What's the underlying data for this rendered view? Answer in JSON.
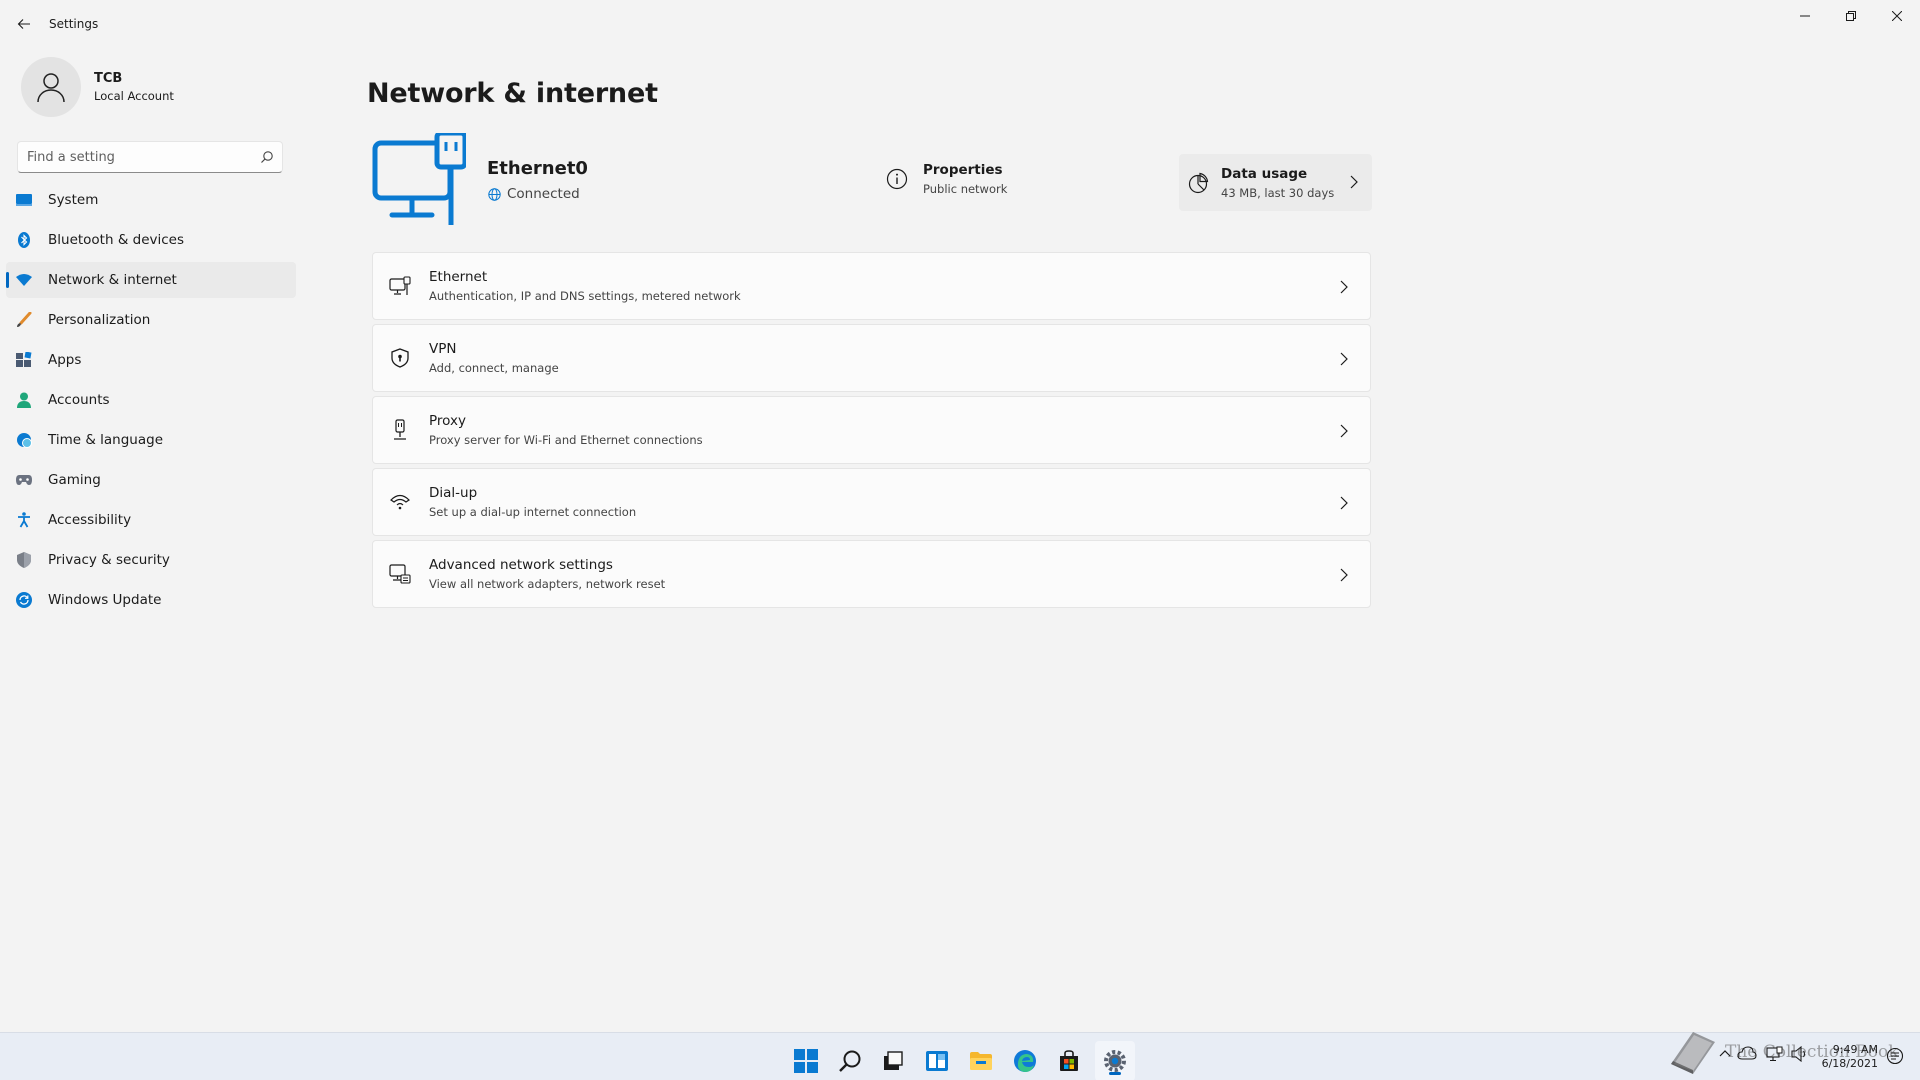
{
  "window": {
    "app_title": "Settings"
  },
  "profile": {
    "name": "TCB",
    "account_type": "Local Account"
  },
  "search": {
    "placeholder": "Find a setting"
  },
  "sidebar": {
    "items": [
      {
        "label": "System",
        "icon": "system-icon",
        "active": false
      },
      {
        "label": "Bluetooth & devices",
        "icon": "bluetooth-icon",
        "active": false
      },
      {
        "label": "Network & internet",
        "icon": "wifi-icon",
        "active": true
      },
      {
        "label": "Personalization",
        "icon": "brush-icon",
        "active": false
      },
      {
        "label": "Apps",
        "icon": "apps-icon",
        "active": false
      },
      {
        "label": "Accounts",
        "icon": "person-icon",
        "active": false
      },
      {
        "label": "Time & language",
        "icon": "globe-clock-icon",
        "active": false
      },
      {
        "label": "Gaming",
        "icon": "gamepad-icon",
        "active": false
      },
      {
        "label": "Accessibility",
        "icon": "accessibility-icon",
        "active": false
      },
      {
        "label": "Privacy & security",
        "icon": "shield-icon",
        "active": false
      },
      {
        "label": "Windows Update",
        "icon": "update-icon",
        "active": false
      }
    ]
  },
  "main": {
    "title": "Network & internet",
    "connection": {
      "name": "Ethernet0",
      "status": "Connected"
    },
    "properties": {
      "title": "Properties",
      "subtitle": "Public network"
    },
    "data_usage": {
      "title": "Data usage",
      "subtitle": "43 MB, last 30 days"
    },
    "rows": [
      {
        "title": "Ethernet",
        "subtitle": "Authentication, IP and DNS settings, metered network",
        "icon": "ethernet-icon"
      },
      {
        "title": "VPN",
        "subtitle": "Add, connect, manage",
        "icon": "vpn-shield-icon"
      },
      {
        "title": "Proxy",
        "subtitle": "Proxy server for Wi-Fi and Ethernet connections",
        "icon": "proxy-icon"
      },
      {
        "title": "Dial-up",
        "subtitle": "Set up a dial-up internet connection",
        "icon": "dialup-icon"
      },
      {
        "title": "Advanced network settings",
        "subtitle": "View all network adapters, network reset",
        "icon": "advanced-network-icon"
      }
    ]
  },
  "taskbar": {
    "clock_time": "9:49 AM",
    "clock_date": "6/18/2021",
    "watermark": "The Collection Book"
  },
  "colors": {
    "accent": "#0067c0",
    "background": "#f3f3f3",
    "card": "#fbfbfb"
  }
}
